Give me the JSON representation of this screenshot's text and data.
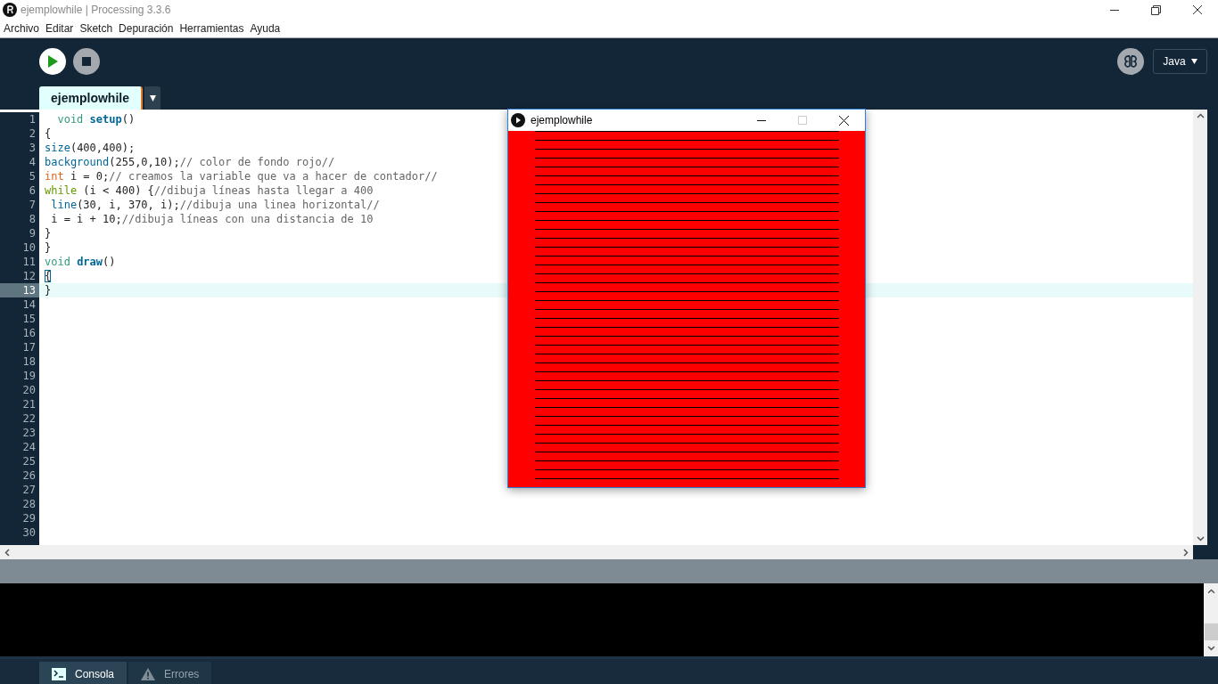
{
  "window": {
    "title": "ejemplowhile | Processing 3.3.6"
  },
  "menu": [
    "Archivo",
    "Editar",
    "Sketch",
    "Depuración",
    "Herramientas",
    "Ayuda"
  ],
  "toolbar": {
    "mode": "Java"
  },
  "tabs": [
    {
      "label": "ejemplowhile",
      "selected": true
    }
  ],
  "editor": {
    "lines": [
      {
        "number": "1",
        "current": false,
        "segments": [
          {
            "kind": "type",
            "text": "  void "
          },
          {
            "kind": "function_bold",
            "text": "setup"
          },
          {
            "kind": "plain",
            "text": "()"
          }
        ]
      },
      {
        "number": "2",
        "current": false,
        "segments": [
          {
            "kind": "plain",
            "text": "{"
          }
        ]
      },
      {
        "number": "3",
        "current": false,
        "segments": [
          {
            "kind": "function",
            "text": "size"
          },
          {
            "kind": "plain",
            "text": "(400,400);"
          }
        ]
      },
      {
        "number": "4",
        "current": false,
        "segments": [
          {
            "kind": "function",
            "text": "background"
          },
          {
            "kind": "plain",
            "text": "(255,0,10);"
          },
          {
            "kind": "comment",
            "text": "// color de fondo rojo//"
          }
        ]
      },
      {
        "number": "5",
        "current": false,
        "segments": [
          {
            "kind": "primitive",
            "text": "int"
          },
          {
            "kind": "plain",
            "text": " i = 0;"
          },
          {
            "kind": "comment",
            "text": "// creamos la variable que va a hacer de contador//"
          }
        ]
      },
      {
        "number": "6",
        "current": false,
        "segments": [
          {
            "kind": "keyword",
            "text": "while"
          },
          {
            "kind": "plain",
            "text": " (i < 400) {"
          },
          {
            "kind": "comment",
            "text": "//dibuja líneas hasta llegar a 400"
          }
        ]
      },
      {
        "number": "7",
        "current": false,
        "segments": [
          {
            "kind": "function",
            "text": " line"
          },
          {
            "kind": "plain",
            "text": "(30, i, 370, i);"
          },
          {
            "kind": "comment",
            "text": "//dibuja una linea horizontal//"
          }
        ]
      },
      {
        "number": "8",
        "current": false,
        "segments": [
          {
            "kind": "plain",
            "text": " i = i + 10;"
          },
          {
            "kind": "comment",
            "text": "//dibuja líneas con una distancia de 10"
          }
        ]
      },
      {
        "number": "9",
        "current": false,
        "segments": [
          {
            "kind": "plain",
            "text": "}"
          }
        ]
      },
      {
        "number": "10",
        "current": false,
        "segments": [
          {
            "kind": "plain",
            "text": "}"
          }
        ]
      },
      {
        "number": "11",
        "current": false,
        "segments": [
          {
            "kind": "type",
            "text": "void "
          },
          {
            "kind": "function_bold",
            "text": "draw"
          },
          {
            "kind": "plain",
            "text": "()"
          }
        ]
      },
      {
        "number": "12",
        "current": false,
        "segments": [
          {
            "kind": "bracket_match",
            "text": "{"
          }
        ]
      },
      {
        "number": "13",
        "current": true,
        "segments": [
          {
            "kind": "plain",
            "text": "}"
          }
        ]
      },
      {
        "number": "14",
        "current": false
      },
      {
        "number": "15",
        "current": false
      },
      {
        "number": "16",
        "current": false
      },
      {
        "number": "17",
        "current": false
      },
      {
        "number": "18",
        "current": false
      },
      {
        "number": "19",
        "current": false
      },
      {
        "number": "20",
        "current": false
      },
      {
        "number": "21",
        "current": false
      },
      {
        "number": "22",
        "current": false
      },
      {
        "number": "23",
        "current": false
      },
      {
        "number": "24",
        "current": false
      },
      {
        "number": "25",
        "current": false
      },
      {
        "number": "26",
        "current": false
      },
      {
        "number": "27",
        "current": false
      },
      {
        "number": "28",
        "current": false
      },
      {
        "number": "29",
        "current": false
      },
      {
        "number": "30",
        "current": false
      }
    ]
  },
  "sketch_window": {
    "title": "ejemplowhile"
  },
  "console_tabs": [
    {
      "label": "Consola",
      "kind": "console",
      "selected": true
    },
    {
      "label": "Errores",
      "kind": "errors",
      "selected": false
    }
  ]
}
